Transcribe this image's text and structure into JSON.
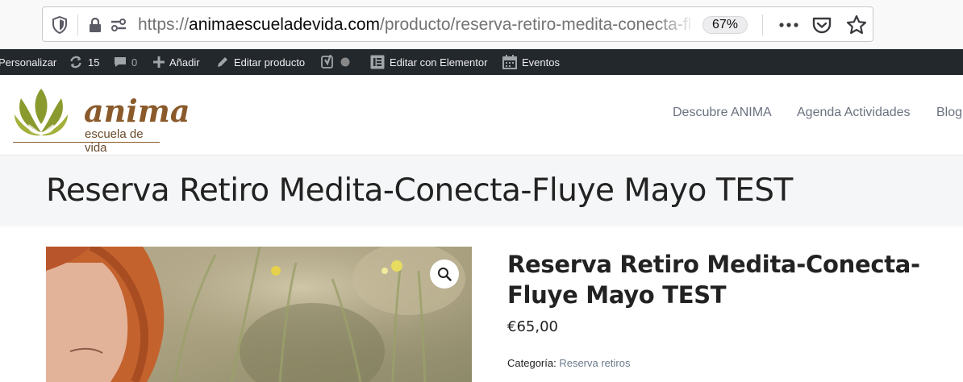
{
  "browser": {
    "url_prefix": "https://",
    "url_domain": "animaescueladevida.com",
    "url_path": "/producto/reserva-retiro-medita-conecta-fl",
    "zoom": "67%"
  },
  "adminbar": {
    "personalizar": "Personalizar",
    "updates_count": "15",
    "comments_count": "0",
    "add": "Añadir",
    "edit_product": "Editar producto",
    "edit_elementor": "Editar con Elementor",
    "events": "Eventos"
  },
  "site": {
    "logo_main": "anima",
    "logo_sub": "escuela de vida",
    "nav": [
      "Descubre ANIMA",
      "Agenda Actividades",
      "Blog"
    ]
  },
  "page": {
    "title": "Reserva Retiro Medita-Conecta-Fluye Mayo TEST"
  },
  "product": {
    "title": "Reserva Retiro Medita-Conecta-Fluye Mayo TEST",
    "price": "€65,00",
    "category_label": "Categoría:",
    "category_value": "Reserva retiros"
  },
  "colors": {
    "admin_bar": "#23282d",
    "logo_green": "#8a9a2e",
    "logo_brown": "#8a5a2b"
  }
}
